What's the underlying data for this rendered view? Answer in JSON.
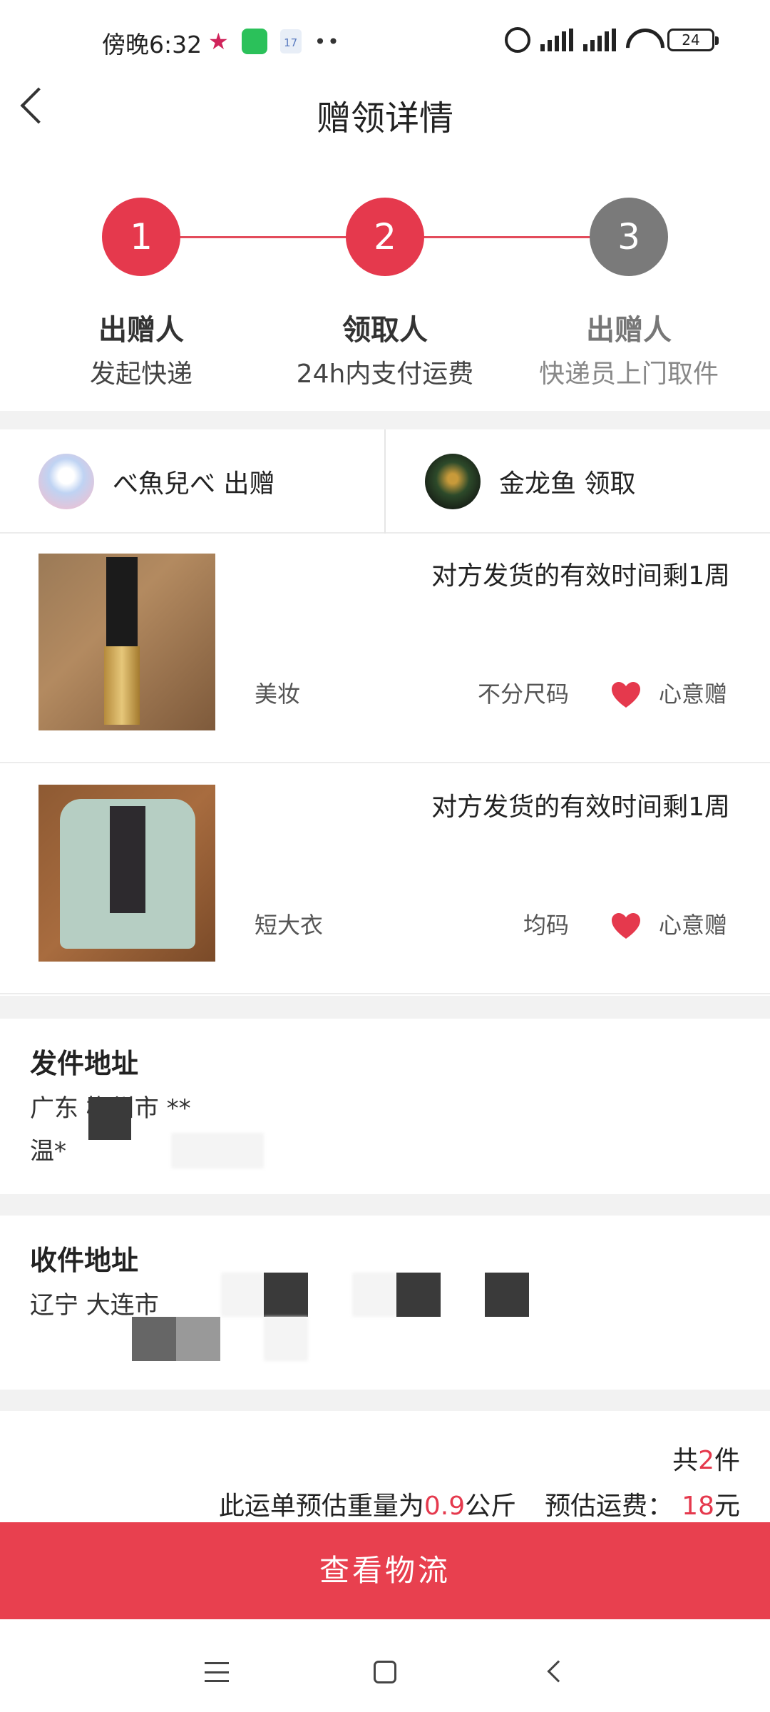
{
  "status_bar": {
    "time": "傍晚6:32",
    "calendar_day": "17",
    "battery": "24",
    "icons": [
      "star-icon",
      "wechat-icon",
      "calendar-icon",
      "more-dots-icon",
      "alarm-icon",
      "hd-signal-icon",
      "signal-icon",
      "wifi-icon",
      "battery-icon"
    ]
  },
  "header": {
    "title": "赠领详情",
    "back_icon": "chevron-left-icon"
  },
  "steps": [
    {
      "number": "1",
      "title": "出赠人",
      "subtitle": "发起快递",
      "state": "active"
    },
    {
      "number": "2",
      "title": "领取人",
      "subtitle": "24h内支付运费",
      "state": "active"
    },
    {
      "number": "3",
      "title": "出赠人",
      "subtitle": "快递员上门取件",
      "state": "inactive"
    }
  ],
  "parties": {
    "sender": {
      "label": "べ魚兒べ 出赠"
    },
    "receiver": {
      "label": "金龙鱼 领取"
    }
  },
  "items": [
    {
      "deadline": "对方发货的有效时间剩1周",
      "category": "美妆",
      "size": "不分尺码",
      "tag": "心意赠"
    },
    {
      "deadline": "对方发货的有效时间剩1周",
      "category": "短大衣",
      "size": "均码",
      "tag": "心意赠"
    }
  ],
  "sender_address": {
    "title": "发件地址",
    "line1": "广东 梅州市        **",
    "line2": "温*"
  },
  "receiver_address": {
    "title": "收件地址",
    "line1": "辽宁 大连市 "
  },
  "summary": {
    "count_prefix": "共",
    "count": "2",
    "count_suffix": "件",
    "weight_prefix": "此运单预估重量为",
    "weight": "0.9",
    "weight_unit": "公斤",
    "fee_prefix": "预估运费：",
    "fee": "18",
    "fee_unit": "元"
  },
  "cta": {
    "label": "查看物流"
  },
  "colors": {
    "accent": "#e5394d",
    "inactive": "#7a7a7a",
    "divider": "#f2f2f2"
  }
}
